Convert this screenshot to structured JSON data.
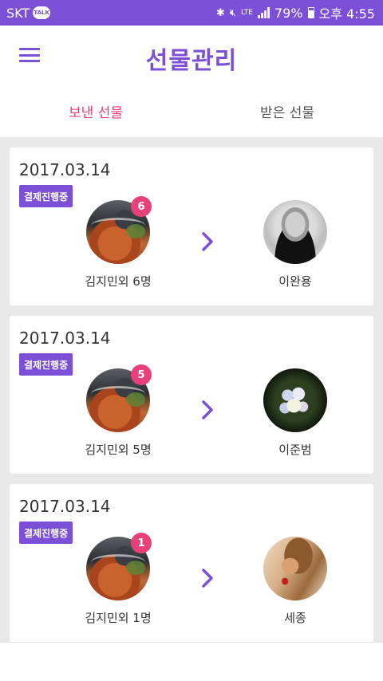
{
  "status_bar": {
    "carrier": "SKT",
    "talk_badge": "TALK",
    "network": "LTE",
    "battery_percent": "79%",
    "time": "오후 4:55",
    "icons": [
      "bluetooth-icon",
      "mute-icon",
      "signal-icon",
      "battery-icon"
    ]
  },
  "header": {
    "title": "선물관리",
    "menu_icon": "hamburger-menu-icon"
  },
  "tabs": [
    {
      "label": "보낸 선물",
      "active": true
    },
    {
      "label": "받은 선물",
      "active": false
    }
  ],
  "gifts": [
    {
      "date": "2017.03.14",
      "status": "결제진행중",
      "sender_count": "6",
      "sender_label": "김지민외 6명",
      "receiver": "이완용"
    },
    {
      "date": "2017.03.14",
      "status": "결제진행중",
      "sender_count": "5",
      "sender_label": "김지민외 5명",
      "receiver": "이준범"
    },
    {
      "date": "2017.03.14",
      "status": "결제진행중",
      "sender_count": "1",
      "sender_label": "김지민외 1명",
      "receiver": "세종"
    }
  ],
  "colors": {
    "primary": "#7b4fd6",
    "accent": "#e8417a"
  }
}
